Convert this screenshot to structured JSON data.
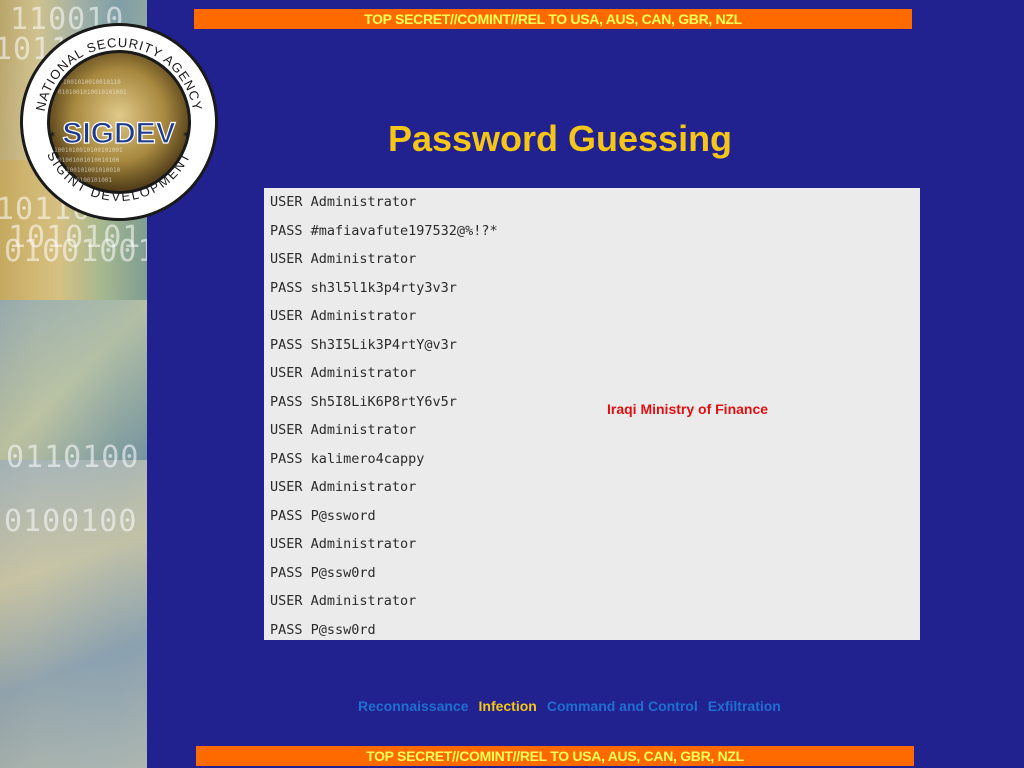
{
  "classification": {
    "top": "TOP SECRET//COMINT//REL TO USA, AUS, CAN, GBR, NZL",
    "bottom": "TOP SECRET//COMINT//REL TO USA, AUS, CAN, GBR, NZL"
  },
  "seal": {
    "ring_text_top": "NATIONAL SECURITY AGENCY",
    "center_text": "SIGDEV",
    "ring_text_bottom": "SIGINT DEVELOPMENT"
  },
  "title": "Password Guessing",
  "log_lines": [
    "USER Administrator",
    "PASS #mafiavafute197532@%!?*",
    "USER Administrator",
    "PASS sh3l5l1k3p4rty3v3r",
    "USER Administrator",
    "PASS Sh3I5Lik3P4rtY@v3r",
    "USER Administrator",
    "PASS Sh5I8LiK6P8rtY6v5r",
    "USER Administrator",
    "PASS kalimero4cappy",
    "USER Administrator",
    "PASS P@ssword",
    "USER Administrator",
    "PASS P@ssw0rd",
    "USER Administrator",
    "PASS P@ssw0rd"
  ],
  "annotation": "Iraqi Ministry of Finance",
  "nav": [
    {
      "label": "Reconnaissance",
      "active": false
    },
    {
      "label": "Infection",
      "active": true
    },
    {
      "label": "Command and Control",
      "active": false
    },
    {
      "label": "Exfiltration",
      "active": false
    }
  ],
  "colors": {
    "background": "#21218f",
    "banner": "#ff6a00",
    "banner_text": "#ffff55",
    "title": "#f5c518",
    "annotation": "#e01010",
    "nav_inactive": "#1f6fd0",
    "nav_active": "#f5c518"
  }
}
